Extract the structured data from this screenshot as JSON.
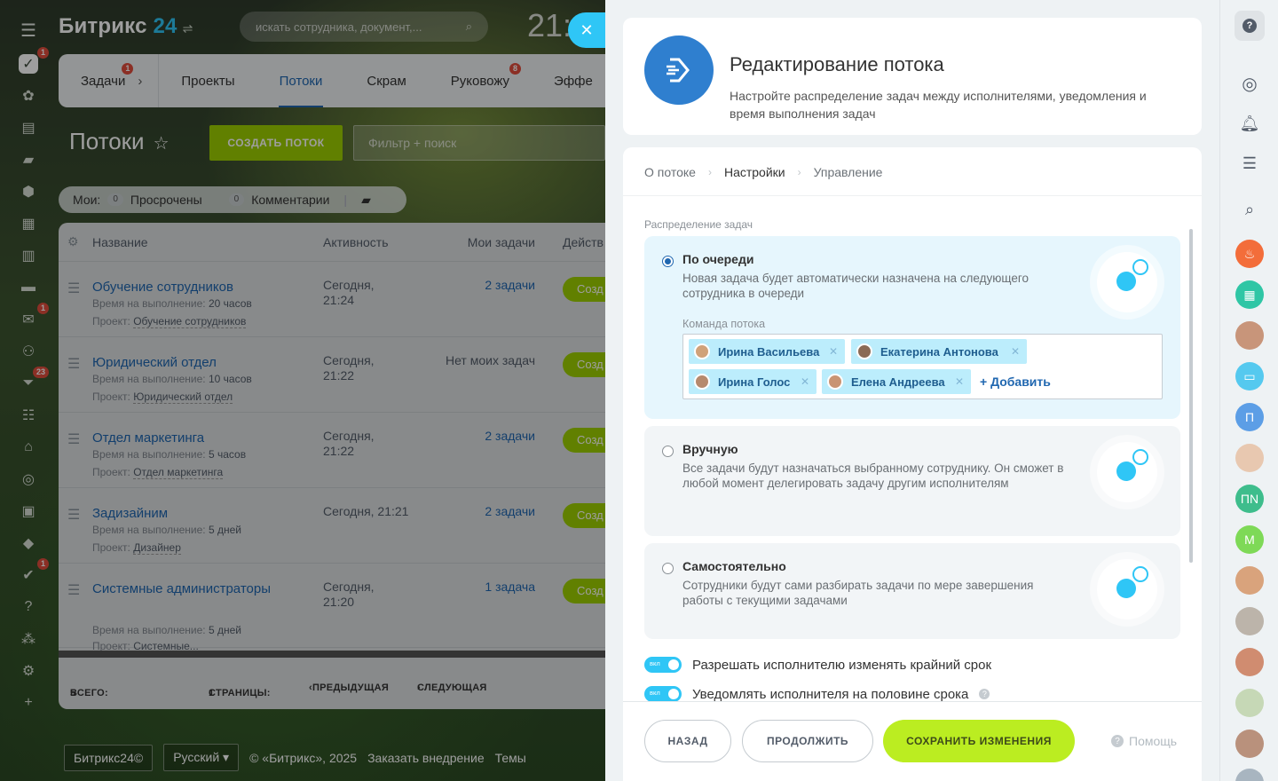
{
  "app": {
    "logo_main": "Битрикс",
    "logo_num": "24",
    "search_placeholder": "искать сотрудника, документ,...",
    "clock": "21:"
  },
  "tabs": [
    {
      "label": "Задачи",
      "badge": "1"
    },
    {
      "label": "Проекты"
    },
    {
      "label": "Потоки"
    },
    {
      "label": "Скрам"
    },
    {
      "label": "Руковожу",
      "badge": "8"
    },
    {
      "label": "Эффе"
    }
  ],
  "left_sidebar_badges": {
    "tasks": "1",
    "mail": "1",
    "sales": "23",
    "bottom": "1"
  },
  "page": {
    "title": "Потоки",
    "create_button": "СОЗДАТЬ ПОТОК",
    "filter_placeholder": "Фильтр + поиск"
  },
  "counters": {
    "mine_label": "Мои:",
    "overdue_count": "0",
    "overdue_label": "Просрочены",
    "comments_count": "0",
    "comments_label": "Комментарии"
  },
  "grid": {
    "headers": {
      "name": "Название",
      "activity": "Активность",
      "my_tasks": "Мои задачи",
      "actions": "Действ"
    },
    "rows": [
      {
        "name": "Обучение сотрудников",
        "time_label": "Время на выполнение:",
        "time": "20 часов",
        "project_label": "Проект:",
        "project": "Обучение сотрудников",
        "activity": "Сегодня,\n21:24",
        "tasks": "2 задачи",
        "button": "Созд"
      },
      {
        "name": "Юридический отдел",
        "time_label": "Время на выполнение:",
        "time": "10 часов",
        "project_label": "Проект:",
        "project": "Юридический отдел",
        "activity": "Сегодня,\n21:22",
        "tasks": "Нет моих задач",
        "button": "Созд"
      },
      {
        "name": "Отдел маркетинга",
        "time_label": "Время на выполнение:",
        "time": "5 часов",
        "project_label": "Проект:",
        "project": "Отдел маркетинга",
        "activity": "Сегодня,\n21:22",
        "tasks": "2 задачи",
        "button": "Созд"
      },
      {
        "name": "Задизайним",
        "time_label": "Время на выполнение:",
        "time": "5 дней",
        "project_label": "Проект:",
        "project": "Дизайнер",
        "activity": "Сегодня, 21:21",
        "tasks": "2 задачи",
        "button": "Созд"
      },
      {
        "name": "Системные администраторы",
        "time_label": "Время на выполнение:",
        "time": "5 дней",
        "project_label": "Проект:",
        "project": "Системные...",
        "activity": "Сегодня,\n21:20",
        "tasks": "1 задача",
        "button": "Созд"
      }
    ],
    "footer": {
      "total_label": "ВСЕГО:",
      "total": "5",
      "pages_label": "СТРАНИЦЫ:",
      "pages": "1",
      "prev": "ПРЕДЫДУЩАЯ",
      "next": "СЛЕДУЮЩАЯ"
    }
  },
  "bottom_footer": {
    "brand": "Битрикс24©",
    "lang": "Русский",
    "copyright": "© «Битрикс», 2025",
    "order": "Заказать внедрение",
    "themes": "Темы"
  },
  "slider": {
    "title": "Редактирование потока",
    "description": "Настройте распределение задач между исполнителями, уведомления и время выполнения задач",
    "steps": [
      "О потоке",
      "Настройки",
      "Управление"
    ],
    "section_label": "Распределение задач",
    "options": [
      {
        "title": "По очереди",
        "desc": "Новая задача будет автоматически назначена на следующего сотрудника в очереди",
        "selected": true
      },
      {
        "title": "Вручную",
        "desc": "Все задачи будут назначаться выбранному сотруднику. Он сможет в любой момент делегировать задачу другим исполнителям",
        "selected": false
      },
      {
        "title": "Самостоятельно",
        "desc": "Сотрудники будут сами разбирать задачи по мере завершения работы с текущими задачами",
        "selected": false
      }
    ],
    "team_label": "Команда потока",
    "team": [
      "Ирина Васильева",
      "Екатерина Антонова",
      "Ирина Голос",
      "Елена Андреева"
    ],
    "add_label": "+ Добавить",
    "toggles": [
      {
        "label": "Разрешать исполнителю изменять крайний срок",
        "state": "вкл"
      },
      {
        "label": "Уведомлять исполнителя на половине срока",
        "state": "вкл"
      }
    ],
    "buttons": {
      "back": "НАЗАД",
      "continue": "ПРОДОЛЖИТЬ",
      "save": "СОХРАНИТЬ ИЗМЕНЕНИЯ",
      "help": "Помощь"
    }
  },
  "right_sidebar": {
    "avatar_letters": [
      "П",
      "ПN",
      "М"
    ]
  },
  "colors": {
    "accent_blue": "#2fc6f6",
    "link_blue": "#2067b0",
    "green": "#9dcf00",
    "save_green": "#bbed21",
    "badge_red": "#e04d3c"
  }
}
